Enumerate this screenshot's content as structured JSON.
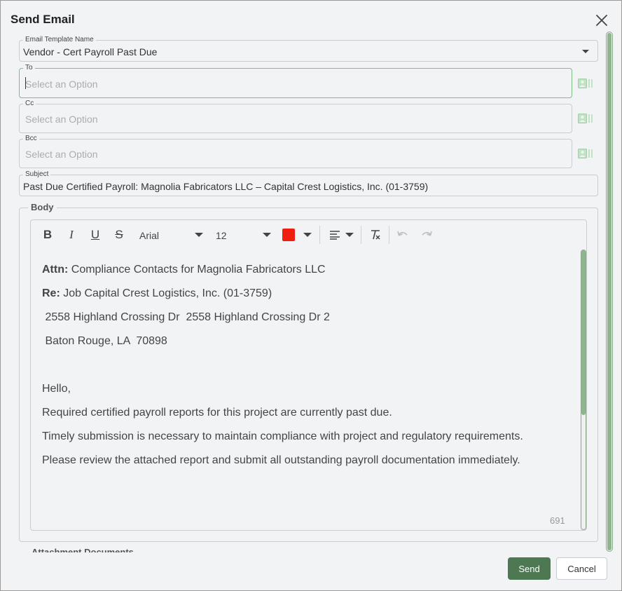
{
  "dialog": {
    "title": "Send Email",
    "close_icon": "close-icon"
  },
  "template": {
    "label": "Email Template Name",
    "value": "Vendor - Cert Payroll Past Due"
  },
  "to": {
    "label": "To",
    "placeholder": "Select an Option"
  },
  "cc": {
    "label": "Cc",
    "placeholder": "Select an Option"
  },
  "bcc": {
    "label": "Bcc",
    "placeholder": "Select an Option"
  },
  "contact_icon": "contact-card-icon",
  "subject": {
    "label": "Subject",
    "value": "Past Due Certified Payroll: Magnolia Fabricators LLC – Capital Crest Logistics, Inc. (01-3759)"
  },
  "body": {
    "label": "Body",
    "toolbar": {
      "bold": "B",
      "italic": "I",
      "underline": "U",
      "strike": "S",
      "font": "Arial",
      "size": "12",
      "text_color": "#f01e0f"
    },
    "content": {
      "attn_label": "Attn:",
      "attn_text": " Compliance Contacts for  Magnolia Fabricators LLC",
      "re_label": "Re:",
      "re_text": " Job Capital Crest Logistics, Inc. (01-3759)",
      "address1": " 2558 Highland Crossing Dr  2558 Highland Crossing Dr 2",
      "address2": " Baton Rouge, LA  70898",
      "greeting": "Hello,",
      "para1": "Required certified payroll reports for this project are currently past due.",
      "para2": "Timely submission is necessary to maintain compliance with project and regulatory requirements.",
      "para3": "Please review the attached report and submit all outstanding payroll documentation immediately."
    },
    "char_count": "691"
  },
  "attachments": {
    "label": "Attachment Documents"
  },
  "actions": {
    "send": "Send",
    "cancel": "Cancel"
  },
  "colors": {
    "accent": "#4e7852",
    "focus_border": "#7bbf86",
    "scrollbar": "#8fb58f"
  }
}
